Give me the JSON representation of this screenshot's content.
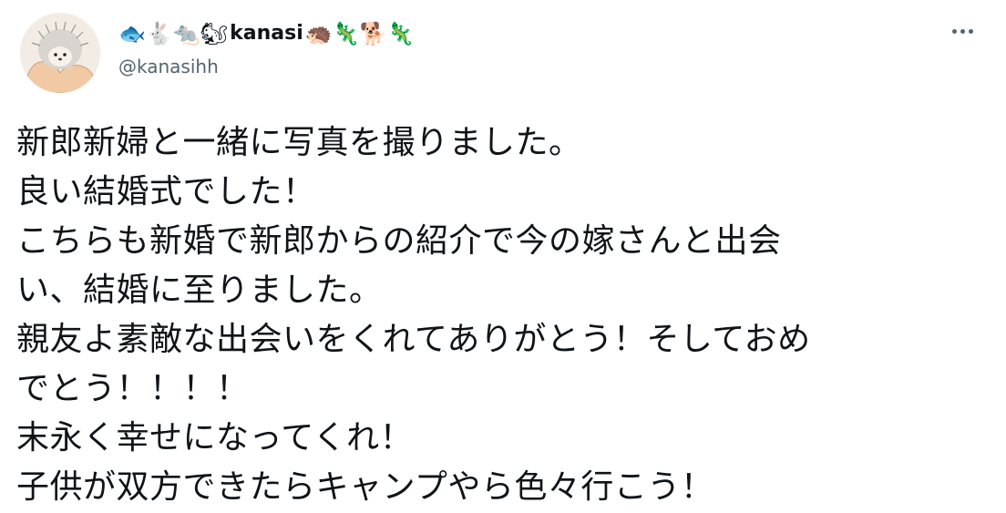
{
  "tweet": {
    "user": {
      "name_prefix_emoji": [
        "🐟",
        "🐇",
        "🐀",
        "🐿"
      ],
      "display_name": "kanasi",
      "name_suffix_emoji": [
        "🦔",
        "🦎",
        "🐕",
        "🦎"
      ],
      "handle": "@kanasihh",
      "avatar_icon": "hedgehog-in-hand"
    },
    "more_icon": "ellipsis-icon",
    "text_lines": [
      "新郎新婦と一緒に写真を撮りました。",
      "良い結婚式でした！",
      "こちらも新婚で新郎からの紹介で今の嫁さんと出会",
      "い、結婚に至りました。",
      "親友よ素敵な出会いをくれてありがとう！そしておめ",
      "でとう！！！！",
      "末永く幸せになってくれ！",
      "子供が双方できたらキャンプやら色々行こう！"
    ]
  },
  "colors": {
    "text_primary": "#0f1419",
    "text_secondary": "#536471",
    "background": "#ffffff"
  }
}
